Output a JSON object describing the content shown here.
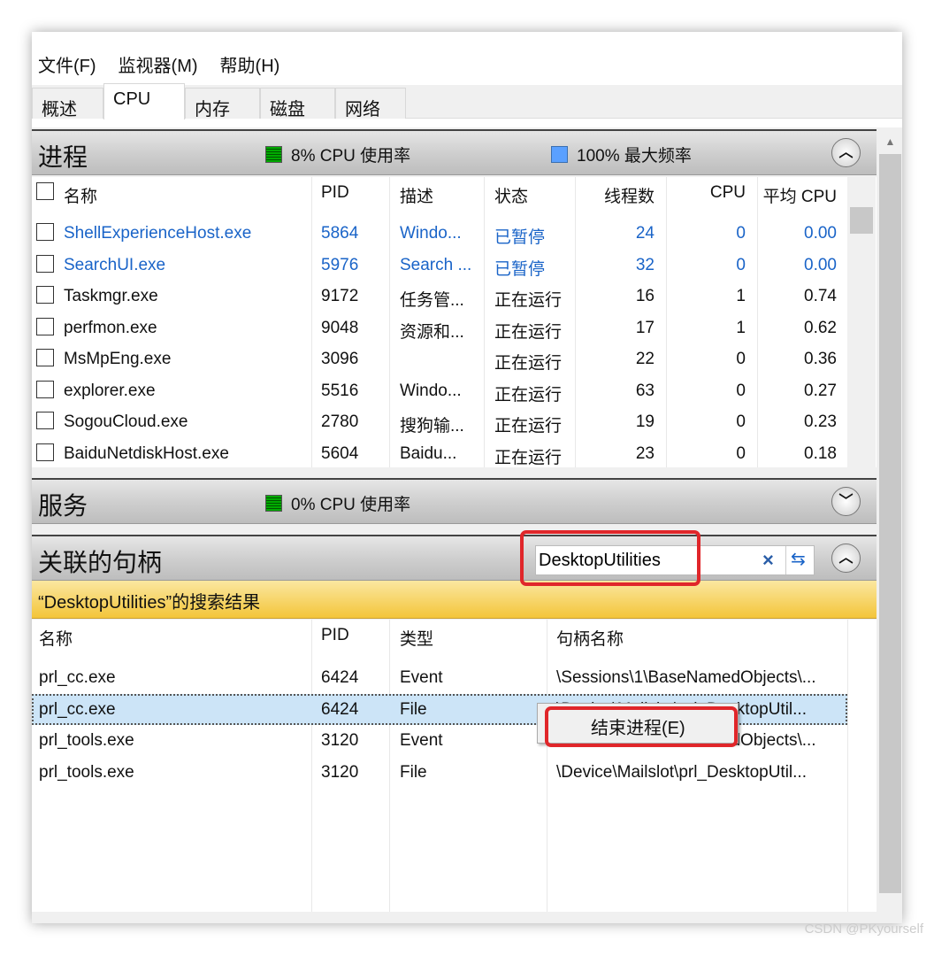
{
  "menu": [
    "文件(F)",
    "监视器(M)",
    "帮助(H)"
  ],
  "tabs": [
    "概述",
    "CPU",
    "内存",
    "磁盘",
    "网络"
  ],
  "active_tab": "CPU",
  "processes": {
    "title": "进程",
    "cpu_usage": "8% CPU 使用率",
    "max_freq": "100% 最大频率",
    "columns": [
      "名称",
      "PID",
      "描述",
      "状态",
      "线程数",
      "CPU",
      "平均 CPU"
    ],
    "rows": [
      {
        "name": "ShellExperienceHost.exe",
        "pid": "5864",
        "desc": "Windo...",
        "status": "已暂停",
        "threads": "24",
        "cpu": "0",
        "avg": "0.00",
        "suspended": true
      },
      {
        "name": "SearchUI.exe",
        "pid": "5976",
        "desc": "Search ...",
        "status": "已暂停",
        "threads": "32",
        "cpu": "0",
        "avg": "0.00",
        "suspended": true
      },
      {
        "name": "Taskmgr.exe",
        "pid": "9172",
        "desc": "任务管...",
        "status": "正在运行",
        "threads": "16",
        "cpu": "1",
        "avg": "0.74"
      },
      {
        "name": "perfmon.exe",
        "pid": "9048",
        "desc": "资源和...",
        "status": "正在运行",
        "threads": "17",
        "cpu": "1",
        "avg": "0.62"
      },
      {
        "name": "MsMpEng.exe",
        "pid": "3096",
        "desc": "",
        "status": "正在运行",
        "threads": "22",
        "cpu": "0",
        "avg": "0.36"
      },
      {
        "name": "explorer.exe",
        "pid": "5516",
        "desc": "Windo...",
        "status": "正在运行",
        "threads": "63",
        "cpu": "0",
        "avg": "0.27"
      },
      {
        "name": "SogouCloud.exe",
        "pid": "2780",
        "desc": "搜狗输...",
        "status": "正在运行",
        "threads": "19",
        "cpu": "0",
        "avg": "0.23"
      },
      {
        "name": "BaiduNetdiskHost.exe",
        "pid": "5604",
        "desc": "Baidu...",
        "status": "正在运行",
        "threads": "23",
        "cpu": "0",
        "avg": "0.18"
      }
    ]
  },
  "services": {
    "title": "服务",
    "cpu_usage": "0% CPU 使用率"
  },
  "handles": {
    "title": "关联的句柄",
    "search_value": "DesktopUtilities",
    "result_label": "“DesktopUtilities”的搜索结果",
    "columns": [
      "名称",
      "PID",
      "类型",
      "句柄名称"
    ],
    "rows": [
      {
        "name": "prl_cc.exe",
        "pid": "6424",
        "type": "Event",
        "handle": "\\Sessions\\1\\BaseNamedObjects\\..."
      },
      {
        "name": "prl_cc.exe",
        "pid": "6424",
        "type": "File",
        "handle": "\\Device\\Mailslot\\prl_DesktopUtil...",
        "selected": true
      },
      {
        "name": "prl_tools.exe",
        "pid": "3120",
        "type": "Event",
        "handle": "\\Sessions\\1\\BaseNamedObjects\\..."
      },
      {
        "name": "prl_tools.exe",
        "pid": "3120",
        "type": "File",
        "handle": "\\Device\\Mailslot\\prl_DesktopUtil..."
      }
    ]
  },
  "context_menu": {
    "end_process": "结束进程(E)"
  },
  "watermark": "CSDN @PKyourself",
  "colors": {
    "highlight": "#e0262a",
    "suspended_text": "#1a64c8",
    "selection": "#cce4f7"
  }
}
